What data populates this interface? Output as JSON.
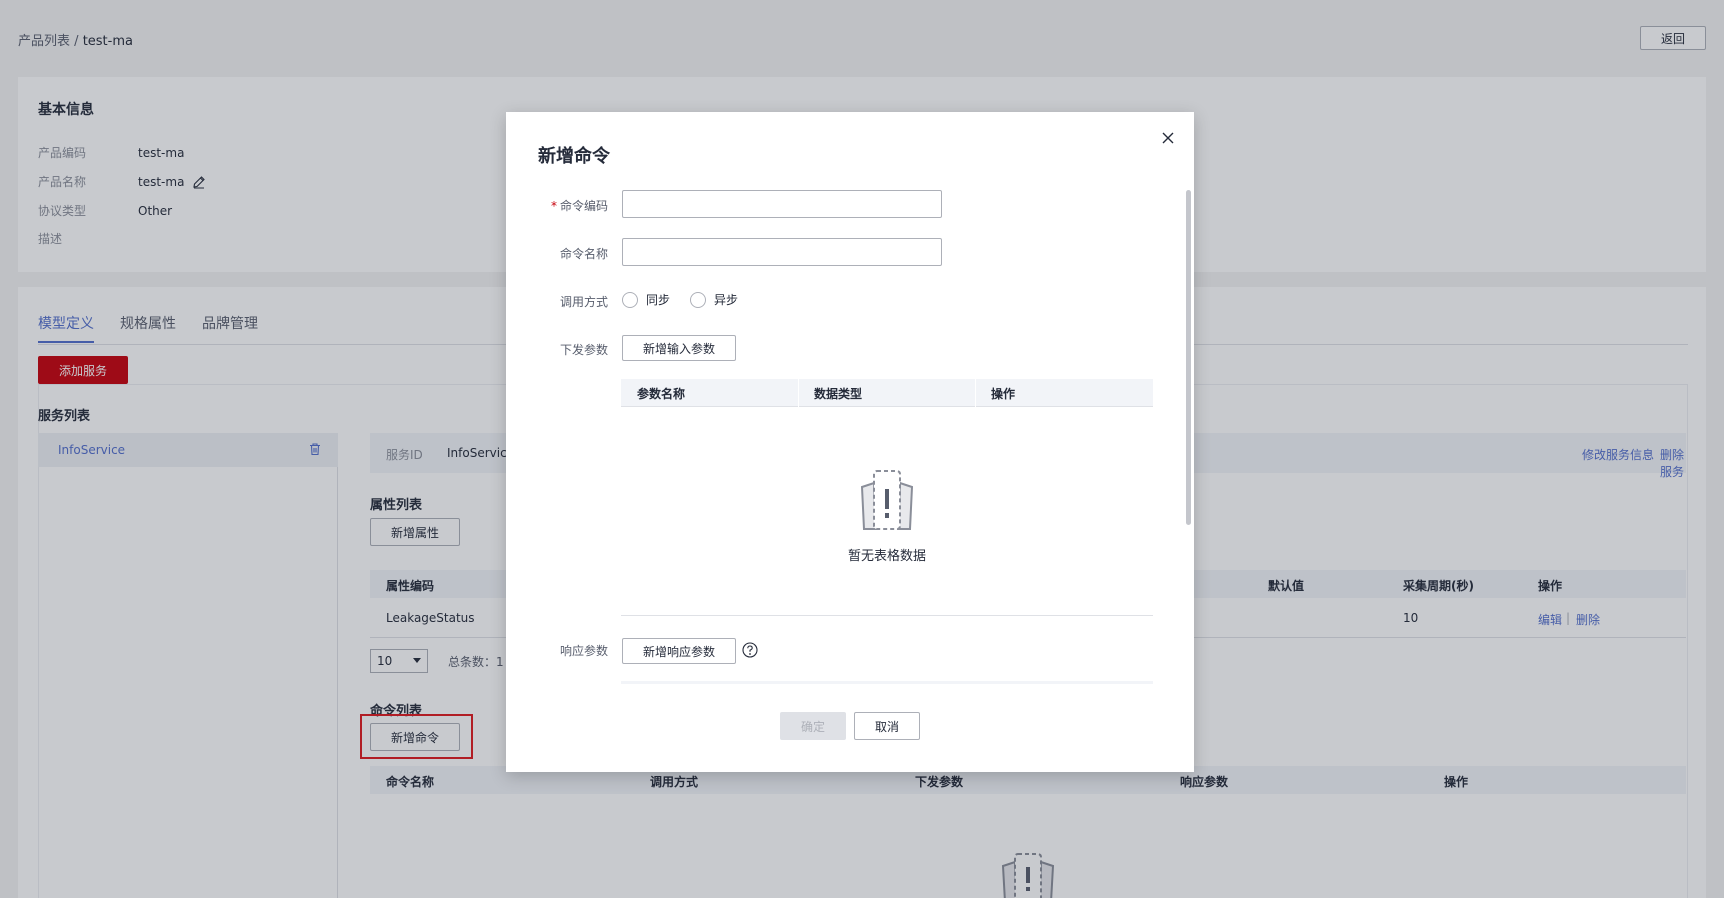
{
  "breadcrumb": {
    "parent": "产品列表",
    "separator": "/",
    "current": "test-ma"
  },
  "back_label": "返回",
  "basic_info": {
    "title": "基本信息",
    "rows": [
      {
        "label": "产品编码",
        "value": "test-ma"
      },
      {
        "label": "产品名称",
        "value": "test-ma"
      },
      {
        "label": "协议类型",
        "value": "Other"
      },
      {
        "label": "描述",
        "value": ""
      }
    ]
  },
  "tabs": [
    {
      "label": "模型定义",
      "active": true
    },
    {
      "label": "规格属性",
      "active": false
    },
    {
      "label": "品牌管理",
      "active": false
    }
  ],
  "add_service_label": "添加服务",
  "service_list_title": "服务列表",
  "services": [
    {
      "name": "InfoService"
    }
  ],
  "service_header": {
    "id_label": "服务ID",
    "id_value": "InfoService",
    "modify_label": "修改服务信息",
    "delete_label": "删除服务"
  },
  "property_section": {
    "title": "属性列表",
    "add_label": "新增属性",
    "columns": [
      "属性编码",
      "默认值",
      "采集周期(秒)",
      "操作"
    ],
    "rows": [
      {
        "code": "LeakageStatus",
        "default": "",
        "period": "10",
        "edit": "编辑",
        "sep": "|",
        "delete": "删除"
      }
    ],
    "page_size": "10",
    "total_label": "总条数：1"
  },
  "command_section": {
    "title": "命令列表",
    "add_label": "新增命令",
    "columns": [
      "命令名称",
      "调用方式",
      "下发参数",
      "响应参数",
      "操作"
    ]
  },
  "modal": {
    "title": "新增命令",
    "fields": {
      "code_label": "命令编码",
      "name_label": "命令名称",
      "call_label": "调用方式",
      "call_options": [
        "同步",
        "异步"
      ],
      "down_label": "下发参数",
      "add_input_label": "新增输入参数",
      "resp_label": "响应参数",
      "add_resp_label": "新增响应参数"
    },
    "param_columns": [
      "参数名称",
      "数据类型",
      "操作"
    ],
    "empty_text": "暂无表格数据",
    "ok_label": "确定",
    "cancel_label": "取消"
  },
  "colors": {
    "brand_red": "#c7000b",
    "link_blue": "#526ecc",
    "highlight": "#e0191e"
  }
}
